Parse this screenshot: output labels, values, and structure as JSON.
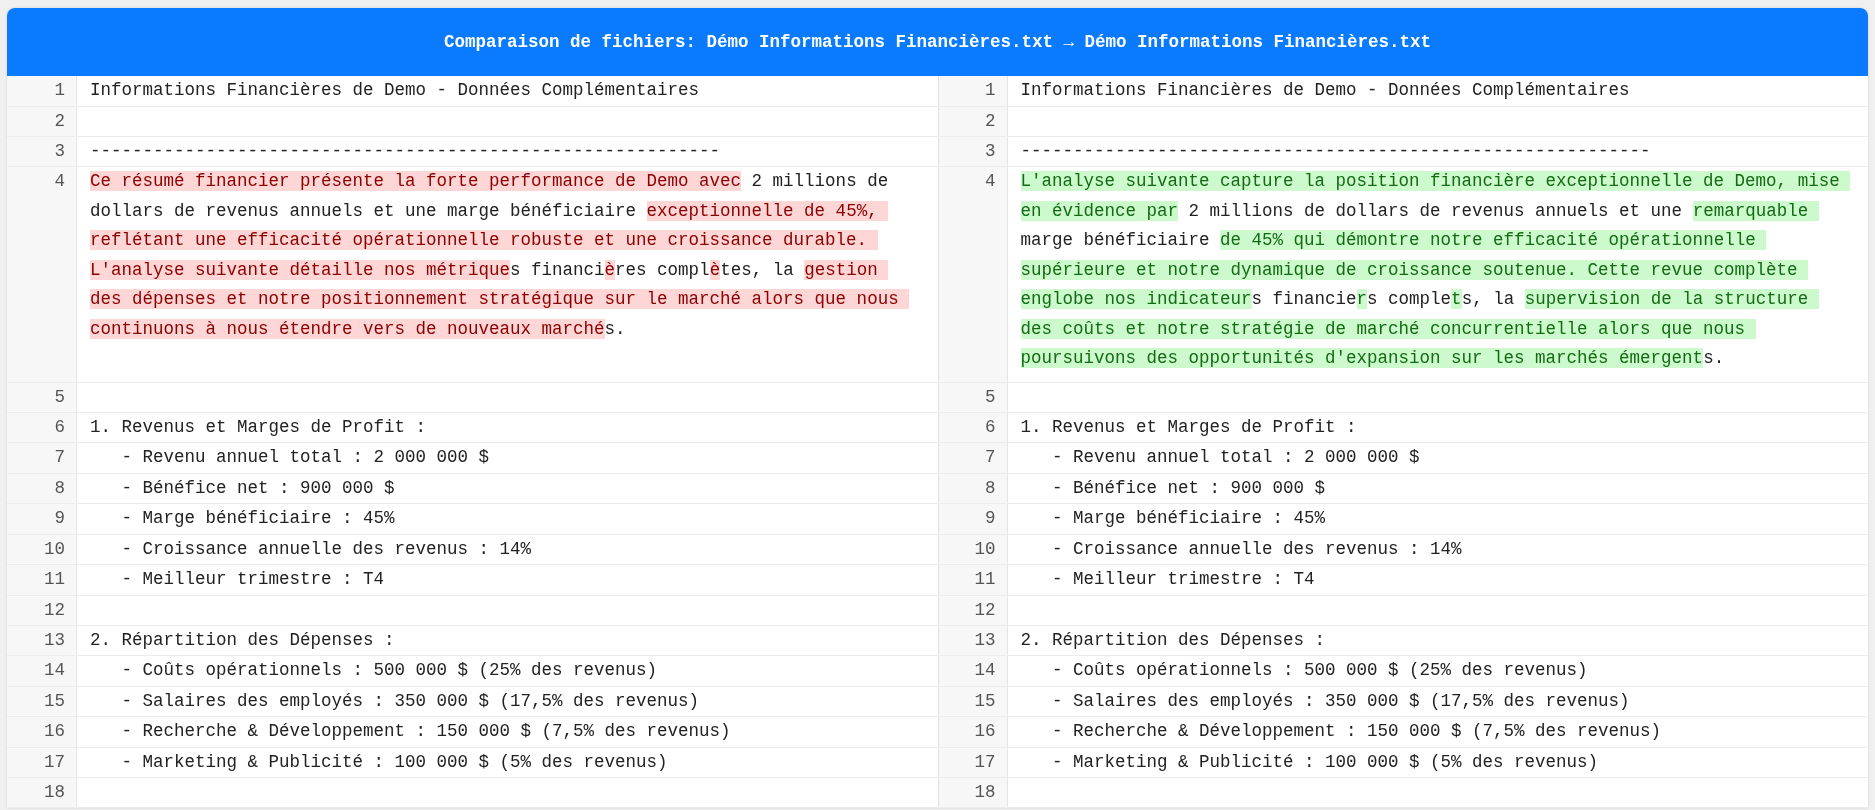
{
  "title": "Comparaison de fichiers: Démo Informations Financières.txt → Démo Informations Financières.txt",
  "rows": [
    {
      "left": {
        "number": "1",
        "text": "Informations Financières de Demo - Données Complémentaires"
      },
      "right": {
        "number": "1",
        "text": "Informations Financières de Demo - Données Complémentaires"
      }
    },
    {
      "left": {
        "number": "2"
      },
      "right": {
        "number": "2"
      }
    },
    {
      "left": {
        "number": "3",
        "text": "------------------------------------------------------------"
      },
      "right": {
        "number": "3",
        "text": "------------------------------------------------------------"
      }
    },
    {
      "left": {
        "number": "4",
        "segments": [
          {
            "text": "Ce résumé financier présente la forte performance de Demo avec",
            "changed": true
          },
          {
            "text": " 2 millions de dollars de revenus annuels et une marge bénéficiaire ",
            "changed": false
          },
          {
            "text": "exceptionnelle de 45%, reflétant une efficacité opérationnelle robuste et une croissance durable. L'analyse suivante détaille nos métrique",
            "changed": true
          },
          {
            "text": "s financi",
            "changed": false
          },
          {
            "text": "è",
            "changed": true
          },
          {
            "text": "res compl",
            "changed": false
          },
          {
            "text": "è",
            "changed": true
          },
          {
            "text": "tes, la ",
            "changed": false
          },
          {
            "text": "gestion des dépenses et notre positionnement stratégique sur le marché alors que nous continuons à nous étendre vers de nouveaux marché",
            "changed": true
          },
          {
            "text": "s.",
            "changed": false
          }
        ]
      },
      "right": {
        "number": "4",
        "segments": [
          {
            "text": "L'analyse suivante capture la position financière exceptionnelle de Demo, mise en évidence par",
            "changed": true
          },
          {
            "text": " 2 millions de dollars de revenus annuels et une ",
            "changed": false
          },
          {
            "text": "remarquable ",
            "changed": true
          },
          {
            "text": "marge bénéficiaire ",
            "changed": false
          },
          {
            "text": "de 45% qui démontre notre efficacité opérationnelle supérieure et notre dynamique de croissance soutenue. Cette revue complète englobe nos indicateur",
            "changed": true
          },
          {
            "text": "s financie",
            "changed": false
          },
          {
            "text": "r",
            "changed": true
          },
          {
            "text": "s comple",
            "changed": false
          },
          {
            "text": "t",
            "changed": true
          },
          {
            "text": "s, la ",
            "changed": false
          },
          {
            "text": "supervision de la structure des coûts et notre stratégie de marché concurrentielle alors que nous poursuivons des opportunités d'expansion sur les marchés émergent",
            "changed": true
          },
          {
            "text": "s.",
            "changed": false
          }
        ]
      }
    },
    {
      "left": {
        "number": "5"
      },
      "right": {
        "number": "5"
      }
    },
    {
      "left": {
        "number": "6",
        "text": "1. Revenus et Marges de Profit :"
      },
      "right": {
        "number": "6",
        "text": "1. Revenus et Marges de Profit :"
      }
    },
    {
      "left": {
        "number": "7",
        "text": "   - Revenu annuel total : 2 000 000 $"
      },
      "right": {
        "number": "7",
        "text": "   - Revenu annuel total : 2 000 000 $"
      }
    },
    {
      "left": {
        "number": "8",
        "text": "   - Bénéfice net : 900 000 $"
      },
      "right": {
        "number": "8",
        "text": "   - Bénéfice net : 900 000 $"
      }
    },
    {
      "left": {
        "number": "9",
        "text": "   - Marge bénéficiaire : 45%"
      },
      "right": {
        "number": "9",
        "text": "   - Marge bénéficiaire : 45%"
      }
    },
    {
      "left": {
        "number": "10",
        "text": "   - Croissance annuelle des revenus : 14%"
      },
      "right": {
        "number": "10",
        "text": "   - Croissance annuelle des revenus : 14%"
      }
    },
    {
      "left": {
        "number": "11",
        "text": "   - Meilleur trimestre : T4"
      },
      "right": {
        "number": "11",
        "text": "   - Meilleur trimestre : T4"
      }
    },
    {
      "left": {
        "number": "12"
      },
      "right": {
        "number": "12"
      }
    },
    {
      "left": {
        "number": "13",
        "text": "2. Répartition des Dépenses :"
      },
      "right": {
        "number": "13",
        "text": "2. Répartition des Dépenses :"
      }
    },
    {
      "left": {
        "number": "14",
        "text": "   - Coûts opérationnels : 500 000 $ (25% des revenus)"
      },
      "right": {
        "number": "14",
        "text": "   - Coûts opérationnels : 500 000 $ (25% des revenus)"
      }
    },
    {
      "left": {
        "number": "15",
        "text": "   - Salaires des employés : 350 000 $ (17,5% des revenus)"
      },
      "right": {
        "number": "15",
        "text": "   - Salaires des employés : 350 000 $ (17,5% des revenus)"
      }
    },
    {
      "left": {
        "number": "16",
        "text": "   - Recherche & Développement : 150 000 $ (7,5% des revenus)"
      },
      "right": {
        "number": "16",
        "text": "   - Recherche & Développement : 150 000 $ (7,5% des revenus)"
      }
    },
    {
      "left": {
        "number": "17",
        "text": "   - Marketing & Publicité : 100 000 $ (5% des revenus)"
      },
      "right": {
        "number": "17",
        "text": "   - Marketing & Publicité : 100 000 $ (5% des revenus)"
      }
    },
    {
      "left": {
        "number": "18"
      },
      "right": {
        "number": "18"
      }
    }
  ]
}
